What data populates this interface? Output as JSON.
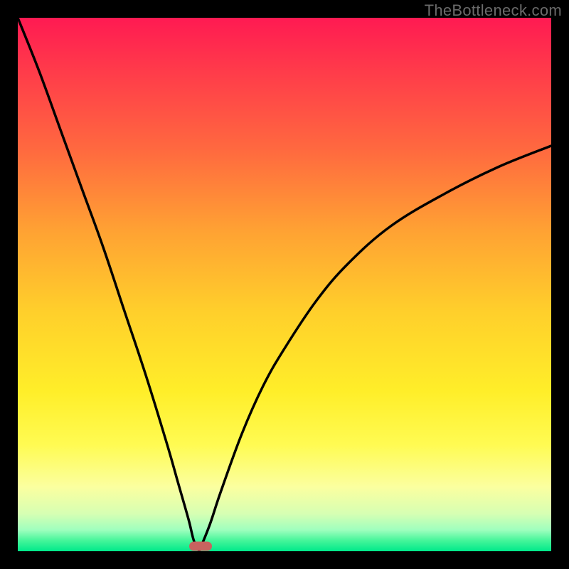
{
  "watermark": "TheBottleneck.com",
  "chart_data": {
    "type": "line",
    "title": "",
    "xlabel": "",
    "ylabel": "",
    "xlim": [
      0,
      100
    ],
    "ylim": [
      0,
      100
    ],
    "grid": false,
    "legend": false,
    "description": "V-shaped asymmetric bottleneck curve on gradient background; minimum near x≈34 at y≈0",
    "series": [
      {
        "name": "left-branch",
        "x": [
          0,
          4,
          8,
          12,
          16,
          20,
          24,
          28,
          30,
          32,
          33,
          34
        ],
        "y": [
          100,
          90,
          79,
          68,
          57,
          45,
          33,
          20,
          13,
          6,
          2,
          0
        ]
      },
      {
        "name": "right-branch",
        "x": [
          34,
          36,
          38,
          42,
          46,
          50,
          56,
          62,
          70,
          80,
          90,
          100
        ],
        "y": [
          0,
          5,
          11,
          22,
          31,
          38,
          47,
          54,
          61,
          67,
          72,
          76
        ]
      }
    ],
    "marker": {
      "x": 34.2,
      "y": 1.0,
      "color": "#c8635f"
    },
    "background_gradient": {
      "top": "#ff1a52",
      "mid": "#ffee29",
      "bottom": "#00e98b"
    }
  }
}
